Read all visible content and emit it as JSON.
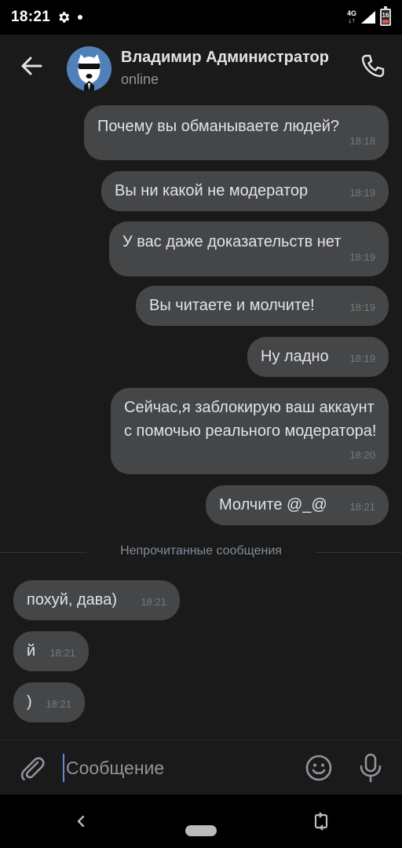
{
  "status_bar": {
    "time": "18:21",
    "network": "4G",
    "battery_level": "16",
    "icons": [
      "gear-icon",
      "notification-dot-icon",
      "signal-icon",
      "battery-icon"
    ]
  },
  "header": {
    "contact_name": "Владимир Администратор",
    "contact_status": "online",
    "icons": [
      "back-arrow-icon",
      "avatar-icon",
      "phone-icon"
    ]
  },
  "messages": [
    {
      "direction": "out",
      "text": "Почему вы обманываете людей?",
      "time": "18:18"
    },
    {
      "direction": "out",
      "text": "Вы ни какой не модератор",
      "time": "18:19"
    },
    {
      "direction": "out",
      "text": "У вас даже доказательств нет",
      "time": "18:19"
    },
    {
      "direction": "out",
      "text": "Вы читаете и молчите!",
      "time": "18:19"
    },
    {
      "direction": "out",
      "text": "Ну ладно",
      "time": "18:19"
    },
    {
      "direction": "out",
      "text": "Сейчас,я заблокирую ваш аккаунт с помочью реального модератора!",
      "time": "18:20"
    },
    {
      "direction": "out",
      "text": "Молчите @_@",
      "time": "18:21"
    },
    {
      "direction": "in",
      "text": "похуй, дава)",
      "time": "18:21"
    },
    {
      "direction": "in",
      "text": "й",
      "time": "18:21"
    },
    {
      "direction": "in",
      "text": ")",
      "time": "18:21"
    }
  ],
  "unread_divider": "Непрочитанные сообщения",
  "composer": {
    "placeholder": "Сообщение",
    "icons": [
      "paperclip-icon",
      "emoji-icon",
      "microphone-icon"
    ]
  },
  "navbar": {
    "icons": [
      "nav-back-icon",
      "nav-home-pill",
      "rotate-icon"
    ]
  },
  "colors": {
    "background": "#1a1a1a",
    "bubble": "#454647",
    "accent": "#5181b8",
    "text": "#e1e3e6",
    "secondary_text": "#8f949c"
  }
}
